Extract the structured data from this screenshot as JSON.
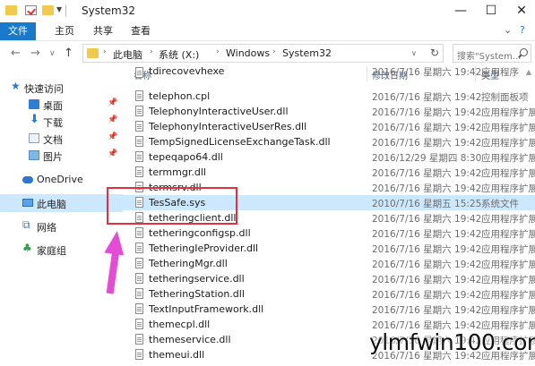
{
  "window": {
    "title": "System32"
  },
  "window_controls": {
    "minimize": "—",
    "maximize": "☐",
    "close": "✕"
  },
  "ribbon": {
    "tabs": [
      {
        "label": "文件",
        "active": true
      },
      {
        "label": "主页",
        "active": false
      },
      {
        "label": "共享",
        "active": false
      },
      {
        "label": "查看",
        "active": false
      }
    ],
    "collapse_glyph": "⌄",
    "help_glyph": "?"
  },
  "address": {
    "crumbs": [
      "此电脑",
      "系统 (X:)",
      "Windows",
      "System32"
    ],
    "search_placeholder": "搜索\"System..."
  },
  "sidebar": {
    "items": [
      {
        "label": "快速访问",
        "icon": "star-icon",
        "pinned": false
      },
      {
        "label": "桌面",
        "icon": "desktop-icon",
        "pinned": true
      },
      {
        "label": "下载",
        "icon": "download-icon",
        "pinned": true
      },
      {
        "label": "文档",
        "icon": "documents-icon",
        "pinned": true
      },
      {
        "label": "图片",
        "icon": "pictures-icon",
        "pinned": true
      },
      {
        "label": "OneDrive",
        "icon": "onedrive-icon",
        "pinned": false
      },
      {
        "label": "此电脑",
        "icon": "this-pc-icon",
        "pinned": false,
        "selected": true
      },
      {
        "label": "网络",
        "icon": "network-icon",
        "pinned": false
      },
      {
        "label": "家庭组",
        "icon": "homegroup-icon",
        "pinned": false
      }
    ]
  },
  "columns": {
    "name": "名称",
    "date": "修改日期",
    "type": "类型"
  },
  "files": [
    {
      "name": "tdirecovevhexe",
      "date": "2016/7/16 星期六 19:42",
      "type": "应用程序"
    },
    {
      "name": "telephon.cpl",
      "date": "2016/7/16 星期六 19:42",
      "type": "控制面板项"
    },
    {
      "name": "TelephonyInteractiveUser.dll",
      "date": "2016/7/16 星期六 19:42",
      "type": "应用程序扩展"
    },
    {
      "name": "TelephonyInteractiveUserRes.dll",
      "date": "2016/7/16 星期六 19:42",
      "type": "应用程序扩展"
    },
    {
      "name": "TempSignedLicenseExchangeTask.dll",
      "date": "2016/7/16 星期六 19:42",
      "type": "应用程序扩展"
    },
    {
      "name": "tepeqapo64.dll",
      "date": "2016/12/29 星期四 8:30",
      "type": "应用程序扩展"
    },
    {
      "name": "termmgr.dll",
      "date": "2016/7/16 星期六 19:42",
      "type": "应用程序扩展"
    },
    {
      "name": "termsrv.dll",
      "date": "2016/7/16 星期六 19:42",
      "type": "应用程序扩展"
    },
    {
      "name": "TesSafe.sys",
      "date": "2010/7/16 星期五 15:25",
      "type": "系统文件",
      "selected": true
    },
    {
      "name": "tetheringclient.dll",
      "date": "2016/7/16 星期六 19:42",
      "type": "应用程序扩展"
    },
    {
      "name": "tetheringconfigsp.dll",
      "date": "2016/7/16 星期六 19:42",
      "type": "应用程序扩展"
    },
    {
      "name": "TetheringIeProvider.dll",
      "date": "2016/7/16 星期六 19:42",
      "type": "应用程序扩展"
    },
    {
      "name": "TetheringMgr.dll",
      "date": "2016/7/16 星期六 19:42",
      "type": "应用程序扩展"
    },
    {
      "name": "tetheringservice.dll",
      "date": "2016/7/16 星期六 19:42",
      "type": "应用程序扩展"
    },
    {
      "name": "TetheringStation.dll",
      "date": "2016/7/16 星期六 19:42",
      "type": "应用程序扩展"
    },
    {
      "name": "TextInputFramework.dll",
      "date": "2016/7/16 星期六 19:42",
      "type": "应用程序扩展"
    },
    {
      "name": "themecpl.dll",
      "date": "2016/7/16 星期六 19:42",
      "type": "应用程序扩展"
    },
    {
      "name": "themeservice.dll",
      "date": "2016/7/16 星期六 19:42",
      "type": "应用程序扩展"
    },
    {
      "name": "themeui.dll",
      "date": "2016/7/16 星期六 19:42",
      "type": "应用程序扩展"
    }
  ],
  "watermark": "ylmfwin100.com",
  "colors": {
    "accent": "#1979ca",
    "selection": "#cce8ff",
    "annotation_box": "#e0313c",
    "annotation_arrow": "#e64bd8"
  }
}
